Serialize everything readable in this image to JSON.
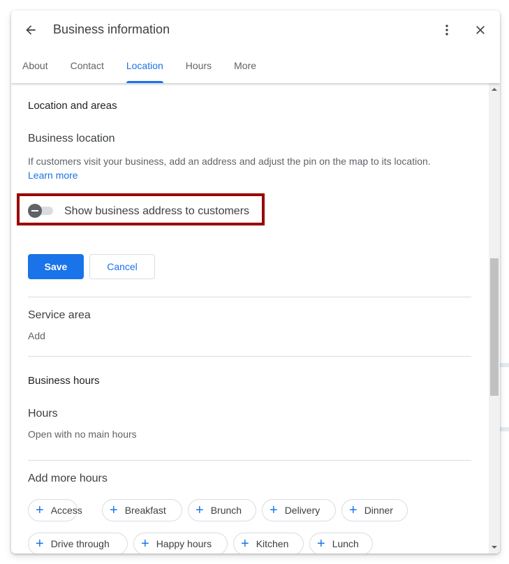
{
  "dialog": {
    "title": "Business information",
    "tabs": [
      {
        "label": "About",
        "active": false
      },
      {
        "label": "Contact",
        "active": false
      },
      {
        "label": "Location",
        "active": true
      },
      {
        "label": "Hours",
        "active": false
      },
      {
        "label": "More",
        "active": false
      }
    ],
    "icons": {
      "back": "arrow-left",
      "more": "more-vert",
      "close": "close"
    }
  },
  "location": {
    "section_title": "Location and areas",
    "business_location": {
      "title": "Business location",
      "description": "If customers visit your business, add an address and adjust the pin on the map to its location.",
      "learn_more": "Learn more",
      "toggle_label": "Show business address to customers",
      "toggle_on": false
    },
    "save_label": "Save",
    "cancel_label": "Cancel",
    "service_area": {
      "title": "Service area",
      "value": "Add"
    }
  },
  "hours": {
    "section_title": "Business hours",
    "hours_title": "Hours",
    "hours_value": "Open with no main hours",
    "more_hours_title": "Add more hours",
    "chips": [
      "Access",
      "Breakfast",
      "Brunch",
      "Delivery",
      "Dinner",
      "Drive through",
      "Happy hours",
      "Kitchen",
      "Lunch"
    ]
  },
  "colors": {
    "accent": "#1a73e8",
    "highlight_border": "#9a0000"
  }
}
